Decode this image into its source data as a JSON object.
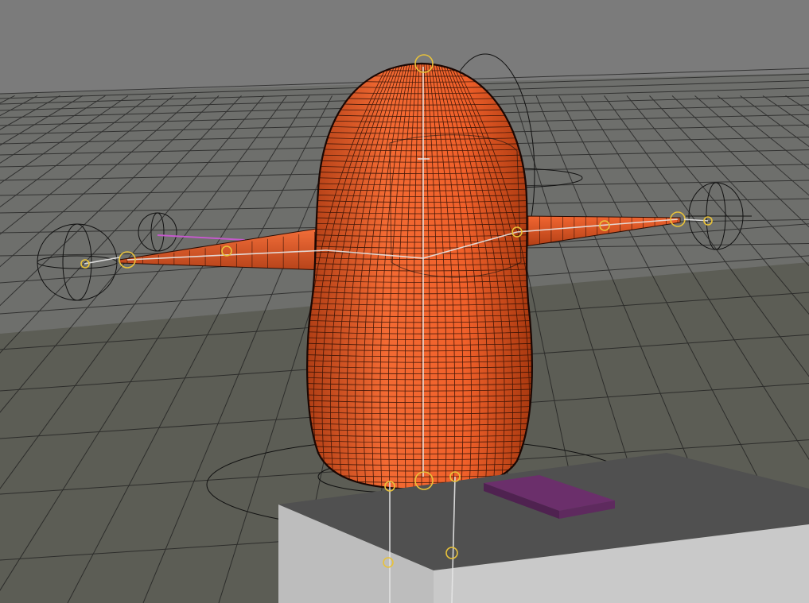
{
  "viewport": {
    "background_color": "#7b7b7b",
    "ground_color": "#5c5d55",
    "grid_line_color": "#1e1e1e",
    "gridlines_visible": true
  },
  "character": {
    "mesh_color": "#f0602a",
    "wire_color": "#2a0d04",
    "shading": "wireframe-on-shaded"
  },
  "rig": {
    "bone_color": "#e6e6e6",
    "joint_color": "#e8c23a",
    "control_color": "#111111",
    "highlight_color": "#c45acb"
  },
  "props": {
    "pedestal_top_color": "#505050",
    "pedestal_side_color": "#c9c9c9",
    "book_color": "#6b2f6b"
  }
}
